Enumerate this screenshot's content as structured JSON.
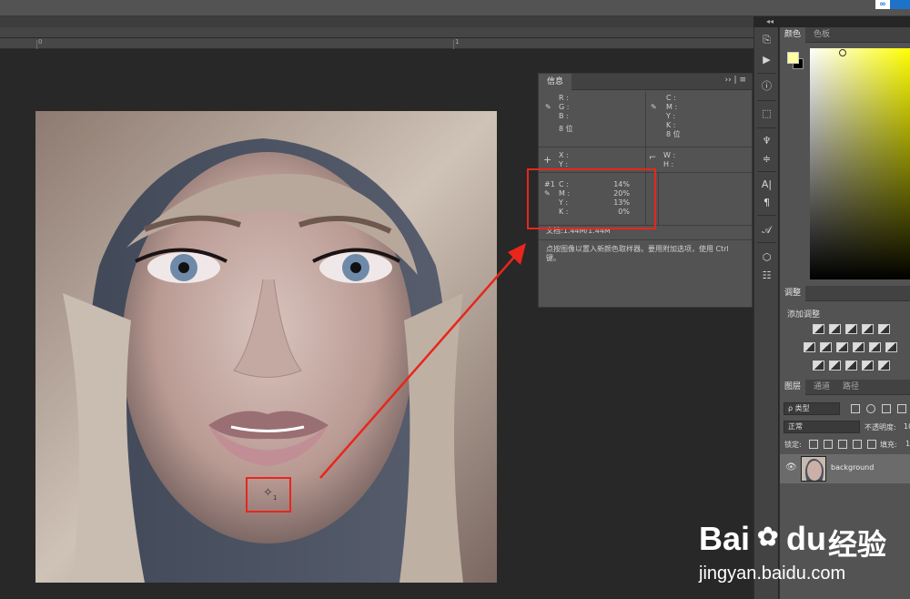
{
  "ruler": {
    "mark_0": "0",
    "mark_1": "1"
  },
  "info": {
    "tab_label": "信息",
    "rgb_labels": [
      "R :",
      "G :",
      "B :"
    ],
    "cmyk_labels": [
      "C :",
      "M :",
      "Y :",
      "K :"
    ],
    "bitdepth_left": "8 位",
    "bitdepth_right": "8 位",
    "xy_labels": [
      "X :",
      "Y :"
    ],
    "wh_labels": [
      "W :",
      "H :"
    ],
    "sampler_id": "#1",
    "sampler_labels": [
      "C :",
      "M :",
      "Y :",
      "K :"
    ],
    "sampler_values": [
      "14%",
      "20%",
      "13%",
      "0%"
    ],
    "doc_text": "文档:1.44M/1.44M",
    "hint_text": "点按图像以置入新颜色取样器。要用附加选项，使用 Ctrl 键。"
  },
  "color_panel": {
    "tab_color": "颜色",
    "tab_swatches": "色板",
    "fg_color": "#ffffa0",
    "bg_color": "#000000"
  },
  "adjustments": {
    "tab": "调整",
    "add_label": "添加调整"
  },
  "layers": {
    "tab_layers": "图层",
    "tab_channels": "通道",
    "tab_paths": "路径",
    "filter_kind": "ρ 类型",
    "blend_mode": "正常",
    "opacity_label": "不透明度:",
    "opacity_value": "10",
    "lock_label": "锁定:",
    "fill_label": "填充:",
    "fill_value": "1",
    "layer_name": "background"
  },
  "sampler_marker": {
    "number": "1"
  },
  "watermark": {
    "brand": "Bai",
    "brand2": "du",
    "cn": "经验",
    "url": "jingyan.baidu.com"
  },
  "topbar": {
    "badge": "∞"
  },
  "accent_red": "#e8261c"
}
